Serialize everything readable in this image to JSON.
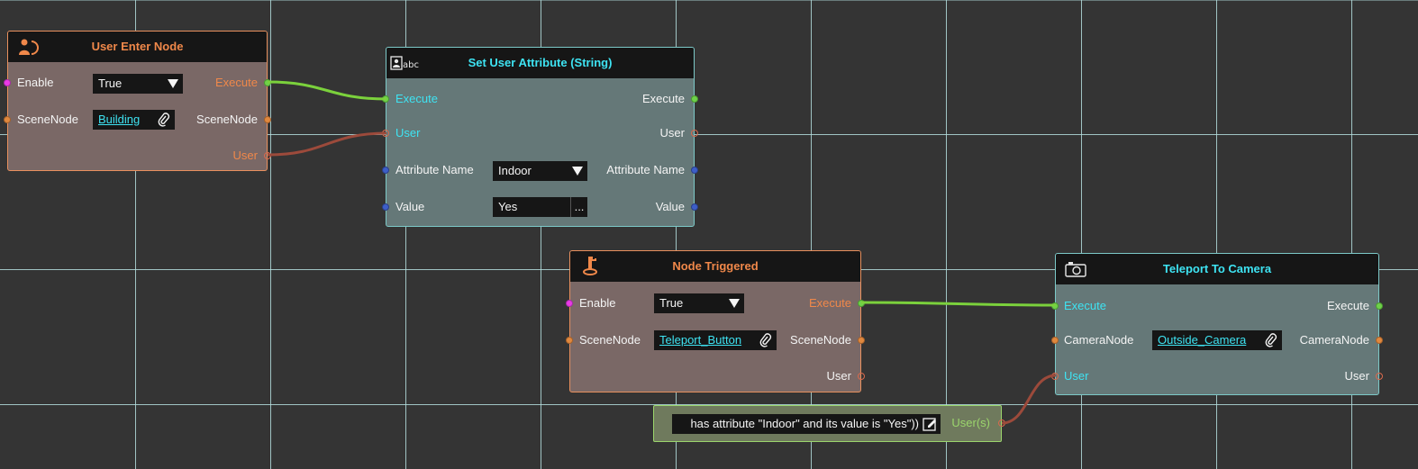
{
  "colors": {
    "canvas": "#343434",
    "grid": "#b4dede",
    "orange_accent": "#f0884a",
    "cyan_accent": "#3ee3f2",
    "exec_wire": "#7bd13c",
    "user_wire": "#9c4a3b"
  },
  "nodes": {
    "user_enter": {
      "icon": "user-enter-icon",
      "title": "User Enter Node",
      "enable_label": "Enable",
      "enable_value": "True",
      "scenenode_in_label": "SceneNode",
      "scenenode_value": "Building",
      "execute_out_label": "Execute",
      "scenenode_out_label": "SceneNode",
      "user_out_label": "User"
    },
    "set_user_attribute": {
      "icon": "user-string-icon",
      "title": "Set User Attribute (String)",
      "execute_in_label": "Execute",
      "user_in_label": "User",
      "attr_name_label": "Attribute Name",
      "attr_name_value": "Indoor",
      "value_label": "Value",
      "value_value": "Yes",
      "value_more": "...",
      "execute_out_label": "Execute",
      "user_out_label": "User",
      "attr_name_out_label": "Attribute Name",
      "value_out_label": "Value"
    },
    "node_triggered": {
      "icon": "node-trigger-icon",
      "title": "Node Triggered",
      "enable_label": "Enable",
      "enable_value": "True",
      "scenenode_in_label": "SceneNode",
      "scenenode_value": "Teleport_Button",
      "execute_out_label": "Execute",
      "scenenode_out_label": "SceneNode",
      "user_out_label": "User"
    },
    "teleport_camera": {
      "icon": "camera-icon",
      "title": "Teleport To Camera",
      "execute_in_label": "Execute",
      "cameranode_in_label": "CameraNode",
      "cameranode_value": "Outside_Camera",
      "user_in_label": "User",
      "execute_out_label": "Execute",
      "cameranode_out_label": "CameraNode",
      "user_out_label": "User"
    },
    "user_filter": {
      "expression": "has attribute \"Indoor\" and its value is \"Yes\"))",
      "out_label": "User(s)"
    }
  }
}
